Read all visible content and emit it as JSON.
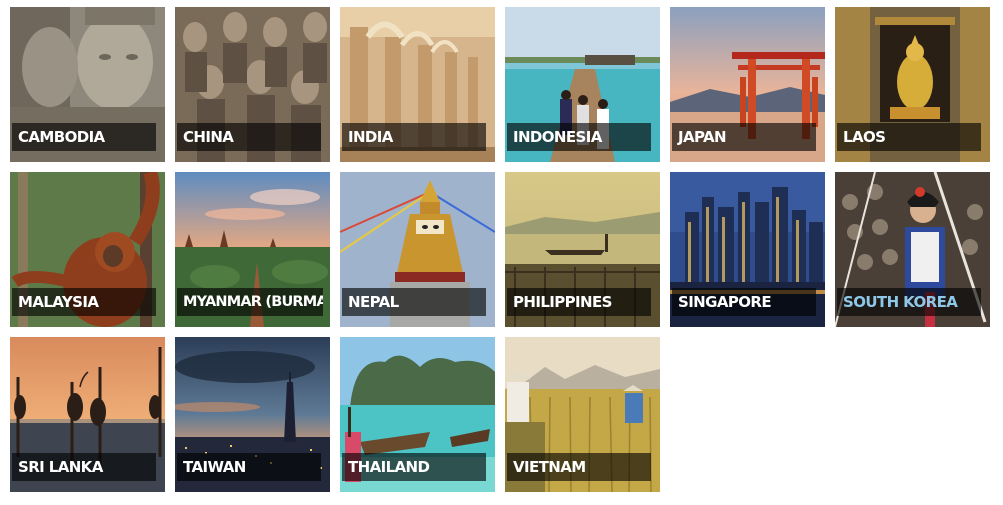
{
  "destinations": [
    {
      "label": "CAMBODIA"
    },
    {
      "label": "CHINA"
    },
    {
      "label": "INDIA"
    },
    {
      "label": "INDONESIA"
    },
    {
      "label": "JAPAN"
    },
    {
      "label": "LAOS"
    },
    {
      "label": "MALAYSIA"
    },
    {
      "label": "MYANMAR (BURMA)"
    },
    {
      "label": "NEPAL"
    },
    {
      "label": "PHILIPPINES"
    },
    {
      "label": "SINGAPORE"
    },
    {
      "label": "SOUTH KOREA"
    },
    {
      "label": "SRI LANKA"
    },
    {
      "label": "TAIWAN"
    },
    {
      "label": "THAILAND"
    },
    {
      "label": "VIETNAM"
    }
  ],
  "colors": {
    "label_bg": "#000000",
    "label_text": "#ffffff",
    "label_hover_text": "#8fc7e8"
  }
}
